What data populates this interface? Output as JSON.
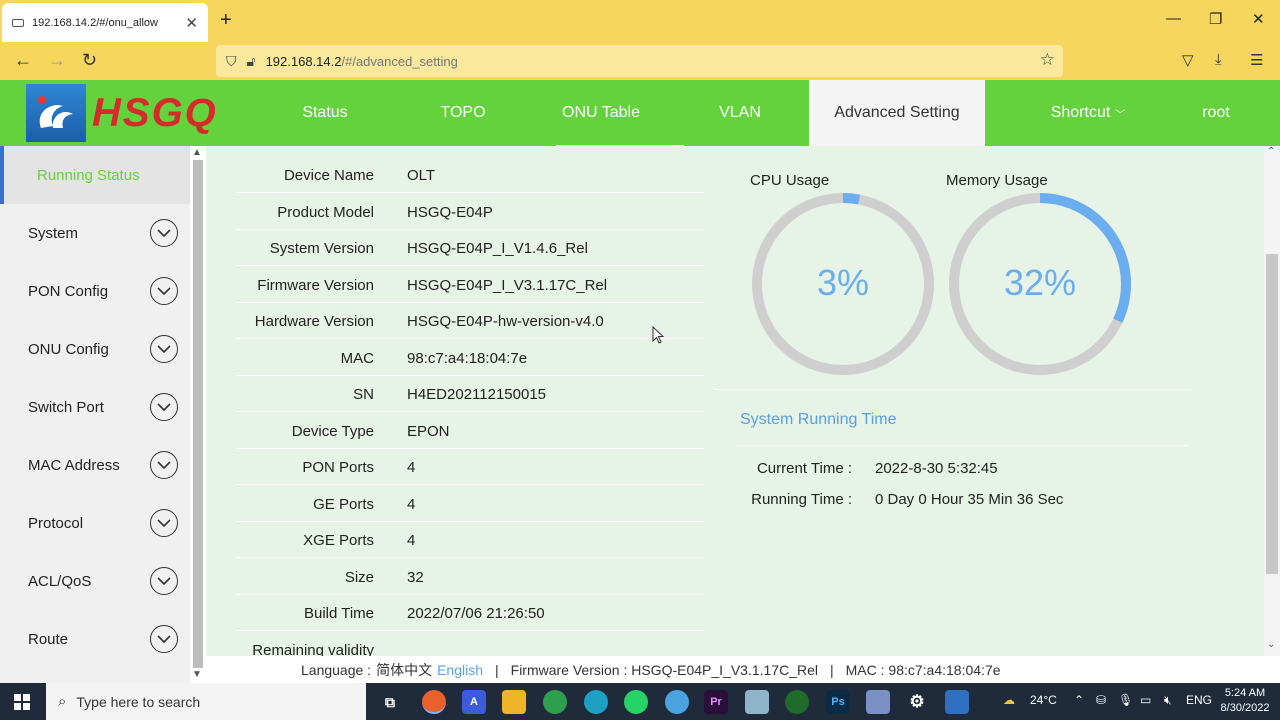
{
  "browser": {
    "tab_title": "192.168.14.2/#/onu_allow",
    "tab_close": "✕",
    "new_tab": "+",
    "url_host": "192.168.14.2",
    "url_path": "/#/advanced_setting"
  },
  "header": {
    "logo_text": "HSGQ",
    "nav": [
      {
        "label": "Status"
      },
      {
        "label": "TOPO"
      },
      {
        "label": "ONU Table"
      },
      {
        "label": "VLAN"
      },
      {
        "label": "Advanced Setting"
      },
      {
        "label": "Shortcut"
      },
      {
        "label": "root"
      }
    ],
    "active_nav": "Advanced Setting"
  },
  "sidebar": {
    "items": [
      {
        "label": "Running Status"
      },
      {
        "label": "System"
      },
      {
        "label": "PON Config"
      },
      {
        "label": "ONU Config"
      },
      {
        "label": "Switch Port"
      },
      {
        "label": "MAC Address"
      },
      {
        "label": "Protocol"
      },
      {
        "label": "ACL/QoS"
      },
      {
        "label": "Route"
      }
    ]
  },
  "device_info": [
    {
      "label": "Device Name",
      "value": "OLT"
    },
    {
      "label": "Product Model",
      "value": "HSGQ-E04P"
    },
    {
      "label": "System Version",
      "value": "HSGQ-E04P_I_V1.4.6_Rel"
    },
    {
      "label": "Firmware Version",
      "value": "HSGQ-E04P_I_V3.1.17C_Rel"
    },
    {
      "label": "Hardware Version",
      "value": "HSGQ-E04P-hw-version-v4.0"
    },
    {
      "label": "MAC",
      "value": "98:c7:a4:18:04:7e"
    },
    {
      "label": "SN",
      "value": "H4ED202112150015"
    },
    {
      "label": "Device Type",
      "value": "EPON"
    },
    {
      "label": "PON Ports",
      "value": "4"
    },
    {
      "label": "GE Ports",
      "value": "4"
    },
    {
      "label": "XGE Ports",
      "value": "4"
    },
    {
      "label": "Size",
      "value": "32"
    },
    {
      "label": "Build Time",
      "value": "2022/07/06 21:26:50"
    },
    {
      "label": "Remaining validity",
      "value": ""
    }
  ],
  "usage": {
    "cpu": {
      "title": "CPU Usage",
      "percent": 3,
      "text": "3%"
    },
    "memory": {
      "title": "Memory Usage",
      "percent": 32,
      "text": "32%"
    }
  },
  "running_time": {
    "title": "System Running Time",
    "current_label": "Current Time :",
    "current_value": "2022-8-30 5:32:45",
    "running_label": "Running Time :",
    "running_value": "0 Day 0 Hour 35 Min 36 Sec"
  },
  "footer": {
    "language_label": "Language :",
    "lang_cn": "简体中文",
    "lang_en": "English",
    "firmware": "Firmware Version : HSGQ-E04P_I_V3.1.17C_Rel",
    "mac": "MAC : 98:c7:a4:18:04:7e",
    "separator": "|"
  },
  "taskbar": {
    "search_placeholder": "Type here to search",
    "weather": "24°C",
    "lang": "ENG",
    "time": "5:24 AM",
    "date": "8/30/2022"
  },
  "colors": {
    "header_green": "#64d23d",
    "accent_blue": "#5aa0e6",
    "main_bg": "#e6f3e6"
  }
}
